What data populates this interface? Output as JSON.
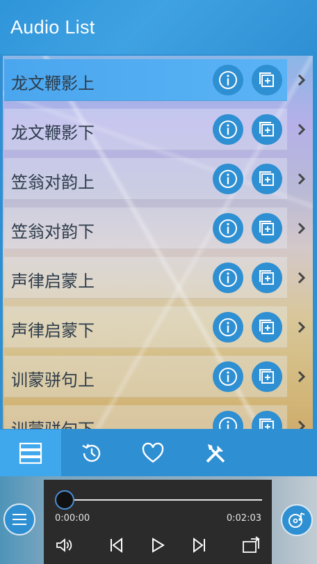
{
  "header": {
    "title": "Audio List"
  },
  "list": {
    "items": [
      {
        "label": "龙文鞭影上"
      },
      {
        "label": "龙文鞭影下"
      },
      {
        "label": "笠翁对韵上"
      },
      {
        "label": "笠翁对韵下"
      },
      {
        "label": "声律启蒙上"
      },
      {
        "label": "声律启蒙下"
      },
      {
        "label": "训蒙骈句上"
      },
      {
        "label": "训蒙骈句下"
      }
    ]
  },
  "nav": {
    "tabs": [
      {
        "icon": "list-icon",
        "active": true
      },
      {
        "icon": "history-icon",
        "active": false
      },
      {
        "icon": "heart-icon",
        "active": false
      },
      {
        "icon": "tools-icon",
        "active": false
      }
    ]
  },
  "player": {
    "current_time": "0:00:00",
    "total_time": "0:02:03",
    "progress": 0
  },
  "colors": {
    "accent": "#2e8fd2",
    "accent_light": "#3fa7ec",
    "panel": "#2b2b2b"
  }
}
